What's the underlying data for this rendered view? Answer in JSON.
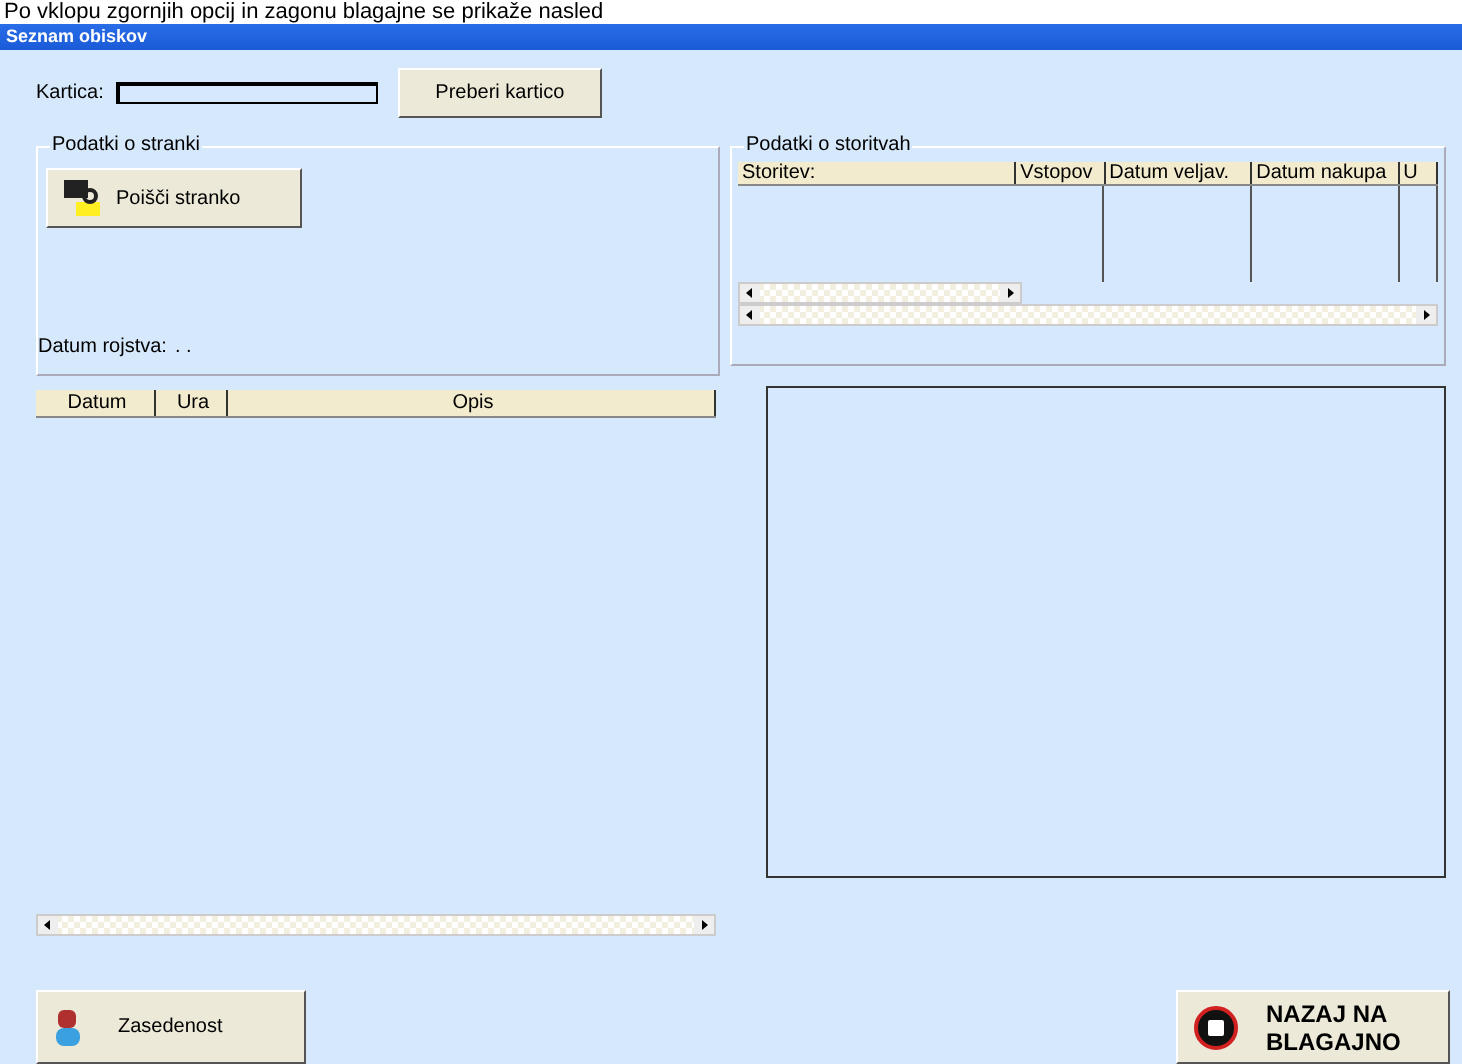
{
  "caption": "Po vklopu zgornjih opcij in zagonu blagajne se prikaže nasled",
  "window": {
    "title": "Seznam obiskov"
  },
  "card": {
    "label": "Kartica:",
    "button": "Preberi kartico"
  },
  "customer_group": {
    "title": "Podatki o stranki",
    "search_button": "Poišči stranko",
    "birth_date_label": "Datum rojstva:",
    "birth_date_value": ". ."
  },
  "services_group": {
    "title": "Podatki o storitvah",
    "columns": [
      "Storitev:",
      "Vstopov",
      "Datum veljav.",
      "Datum nakupa",
      "U"
    ]
  },
  "visits_table": {
    "columns": [
      "Datum",
      "Ura",
      "Opis"
    ]
  },
  "buttons": [
    {
      "label": "Zasedenost",
      "kind": "occupancy"
    },
    {
      "label": "NAZAJ NA BLAGAJNO",
      "kind": "back"
    }
  ]
}
